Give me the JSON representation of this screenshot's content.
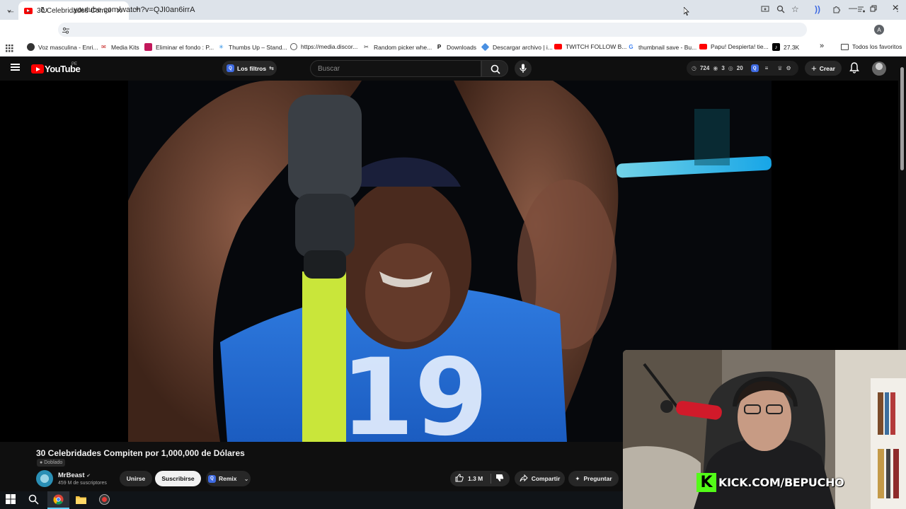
{
  "browser": {
    "tab_title": "30 Celebridades Compiten por",
    "tab_close": "✕",
    "new_tab": "+",
    "url": "youtube.com/watch?v=QJI0an6irrA",
    "bookmarks": [
      {
        "label": "Voz masculina - Enri...",
        "icon": "globe-icon"
      },
      {
        "label": "Media Kits",
        "icon": "mail-icon"
      },
      {
        "label": "Eliminar el fondo : P...",
        "icon": "remove-bg-icon"
      },
      {
        "label": "Thumbs Up – Stand...",
        "icon": "star-icon"
      },
      {
        "label": "https://media.discor...",
        "icon": "globe-icon"
      },
      {
        "label": "Random picker whe...",
        "icon": "tools-icon"
      },
      {
        "label": "Downloads",
        "icon": "p-icon"
      },
      {
        "label": "Descargar archivo | i...",
        "icon": "tag-icon"
      },
      {
        "label": "TWITCH FOLLOW B...",
        "icon": "youtube-icon"
      },
      {
        "label": "thumbnail save - Bu...",
        "icon": "google-icon"
      },
      {
        "label": "Papu! Despierta! tie...",
        "icon": "youtube-icon"
      },
      {
        "label": "27.3K",
        "icon": "tiktok-icon"
      }
    ],
    "more_bookmarks": "»",
    "all_favorites": "Todos los favoritos",
    "profile_letter": "A"
  },
  "youtube": {
    "logo_text": "YouTube",
    "country_code": "PE",
    "filters_label": "Los filtros",
    "search_placeholder": "Buscar",
    "stats": {
      "watch_time": "724",
      "views": "3",
      "other": "20"
    },
    "create_label": "Crear",
    "video": {
      "title": "30 Celebridades Compiten por 1,000,000 de Dólares",
      "dubbed_label": "Doblado",
      "channel_name": "MrBeast",
      "subscribers": "459 M de suscriptores",
      "join_label": "Unirse",
      "subscribe_label": "Suscribirse",
      "remix_label": "Remix",
      "likes": "1.3 M",
      "share_label": "Compartir",
      "ask_label": "Preguntar"
    }
  },
  "overlay": {
    "kick_letter": "K",
    "kick_text": "KICK.COM/BEPUCHO"
  },
  "colors": {
    "youtube_red": "#ff0000",
    "kick_green": "#53fc18",
    "yt_background": "#0f0f0f"
  }
}
